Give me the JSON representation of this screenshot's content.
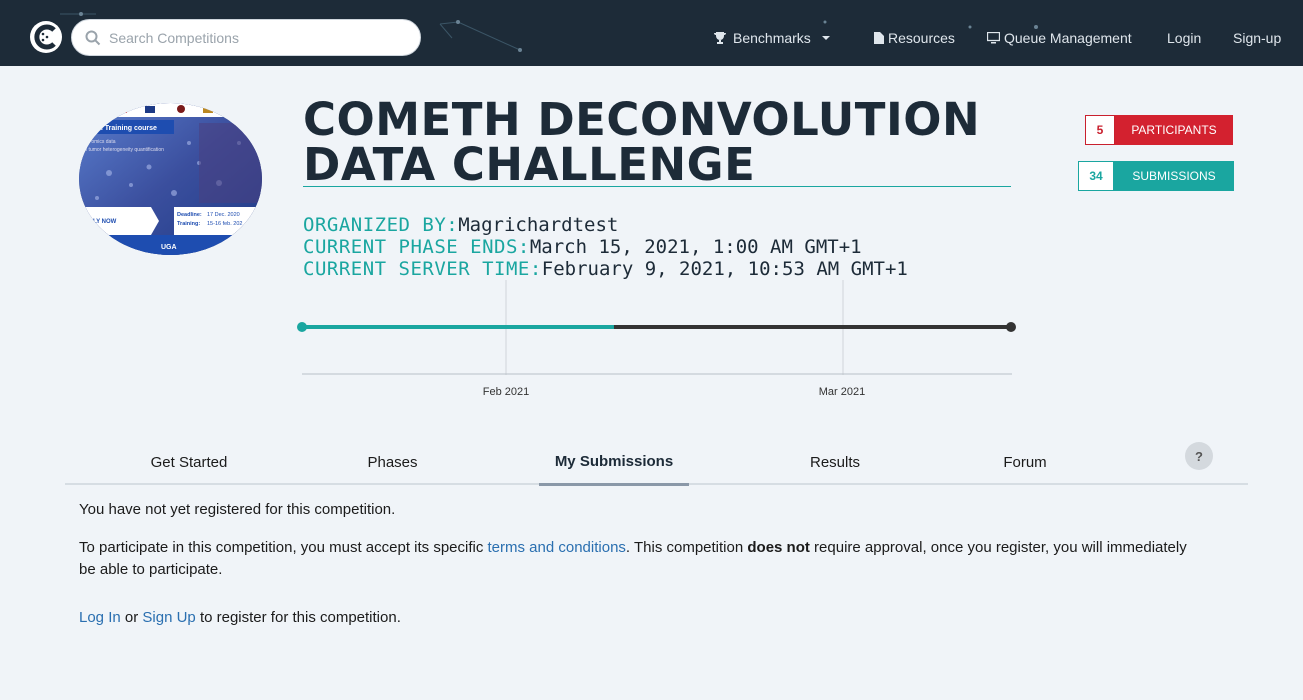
{
  "navbar": {
    "search_placeholder": "Search Competitions",
    "items": [
      {
        "label": "Benchmarks"
      },
      {
        "label": "Resources"
      },
      {
        "label": "Queue Management"
      },
      {
        "label": "Login"
      },
      {
        "label": "Sign-up"
      }
    ]
  },
  "competition": {
    "title_line1": "COMETH DECONVOLUTION",
    "title_line2": "DATA CHALLENGE",
    "organized_by_label": "ORGANIZED BY:",
    "organized_by": "Magrichardtest",
    "phase_ends_label": "CURRENT PHASE ENDS:",
    "phase_ends": "March 15, 2021, 1:00 AM GMT+1",
    "server_time_label": "CURRENT SERVER TIME:",
    "server_time": "February 9, 2021, 10:53 AM GMT+1",
    "logo_texts": {
      "course": "METH Training course",
      "line2": "om omics data",
      "line3": "to tumor heterogeneity quantification",
      "apply": "PLY NOW",
      "deadline_label": "Deadline:",
      "deadline": "17 Dec. 2020",
      "training_label": "Training:",
      "training": "15-16 feb. 202",
      "uga": "UGA"
    }
  },
  "stats": {
    "participants_count": "5",
    "participants_label": "PARTICIPANTS",
    "submissions_count": "34",
    "submissions_label": "SUBMISSIONS"
  },
  "timeline": {
    "progress": 0.44,
    "ticks": [
      "Feb 2021",
      "Mar 2021"
    ],
    "colors": {
      "done": "#1aa6a0",
      "remaining": "#333333"
    }
  },
  "tabs": [
    {
      "label": "Get Started"
    },
    {
      "label": "Phases"
    },
    {
      "label": "My Submissions",
      "active": true
    },
    {
      "label": "Results"
    },
    {
      "label": "Forum"
    }
  ],
  "help": "?",
  "content": {
    "p1": "You have not yet registered for this competition.",
    "p2_a": "To participate in this competition, you must accept its specific ",
    "p2_link": "terms and conditions",
    "p2_b": ". This competition ",
    "p2_bold": "does not",
    "p2_c": " require approval, once you register, you will immediately be able to participate.",
    "p3_login": "Log In",
    "p3_or": " or ",
    "p3_signup": "Sign Up",
    "p3_rest": " to register for this competition."
  },
  "colors": {
    "navbar": "#1d2b38",
    "accent": "#1aa6a0",
    "danger": "#d3212f",
    "link": "#2a6fb0"
  }
}
